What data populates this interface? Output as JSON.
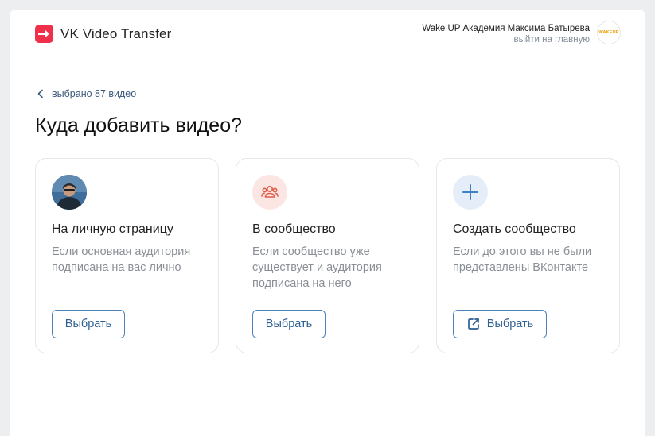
{
  "header": {
    "app_title": "VK Video Transfer",
    "user_name": "Wake UP Академия Максима Батырева",
    "user_link": "выйти на главную",
    "avatar_text": "WAKEUP"
  },
  "nav": {
    "back_label": "выбрано 87 видео"
  },
  "main": {
    "title": "Куда добавить видео?",
    "cards": [
      {
        "icon": "profile-photo",
        "title": "На личную страницу",
        "description": "Если основная аудитория подписана на вас лично",
        "button_label": "Выбрать"
      },
      {
        "icon": "users-icon",
        "title": "В сообщество",
        "description": "Если сообщество уже существует и аудитория подписана на него",
        "button_label": "Выбрать"
      },
      {
        "icon": "plus-icon",
        "title": "Создать сообщество",
        "description": "Если до этого вы не были представлены ВКонтакте",
        "button_label": "Выбрать",
        "button_icon": "external-link-icon"
      }
    ]
  },
  "colors": {
    "brand_red": "#f0304a",
    "accent_blue": "#2e5f91",
    "muted_text": "#8a8f96"
  }
}
